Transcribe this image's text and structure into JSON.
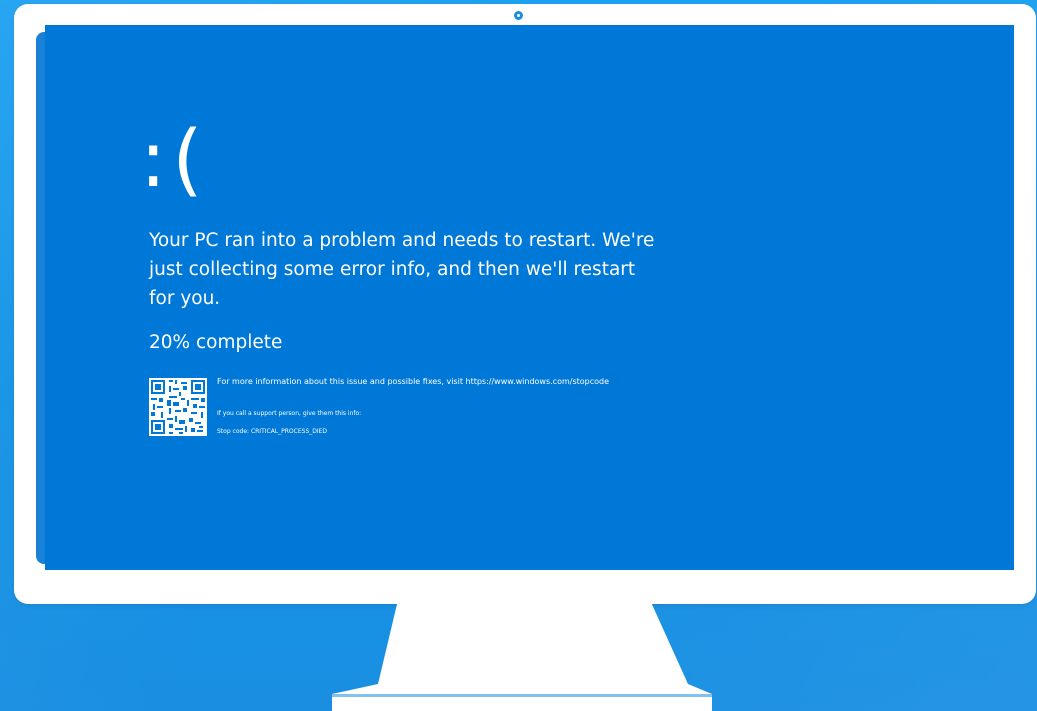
{
  "bsod": {
    "sad_face": ":(",
    "message": "Your PC ran into a problem and needs to restart. We're just collecting some error info, and then we'll restart for you.",
    "progress_percent": 20,
    "progress_text": "20% complete",
    "info_text": "For more information about this issue and possible fixes, visit https://www.windows.com/stopcode",
    "support_text": "If you call a support person, give them this info:",
    "stop_code_text": "Stop code: CRITICAL_PROCESS_DIED"
  },
  "colors": {
    "screen_blue": "#0078d7",
    "background_blue": "#1a96e8",
    "bezel_white": "#ffffff"
  },
  "icons": {
    "qr": "qr-code-icon",
    "camera": "webcam-icon"
  }
}
